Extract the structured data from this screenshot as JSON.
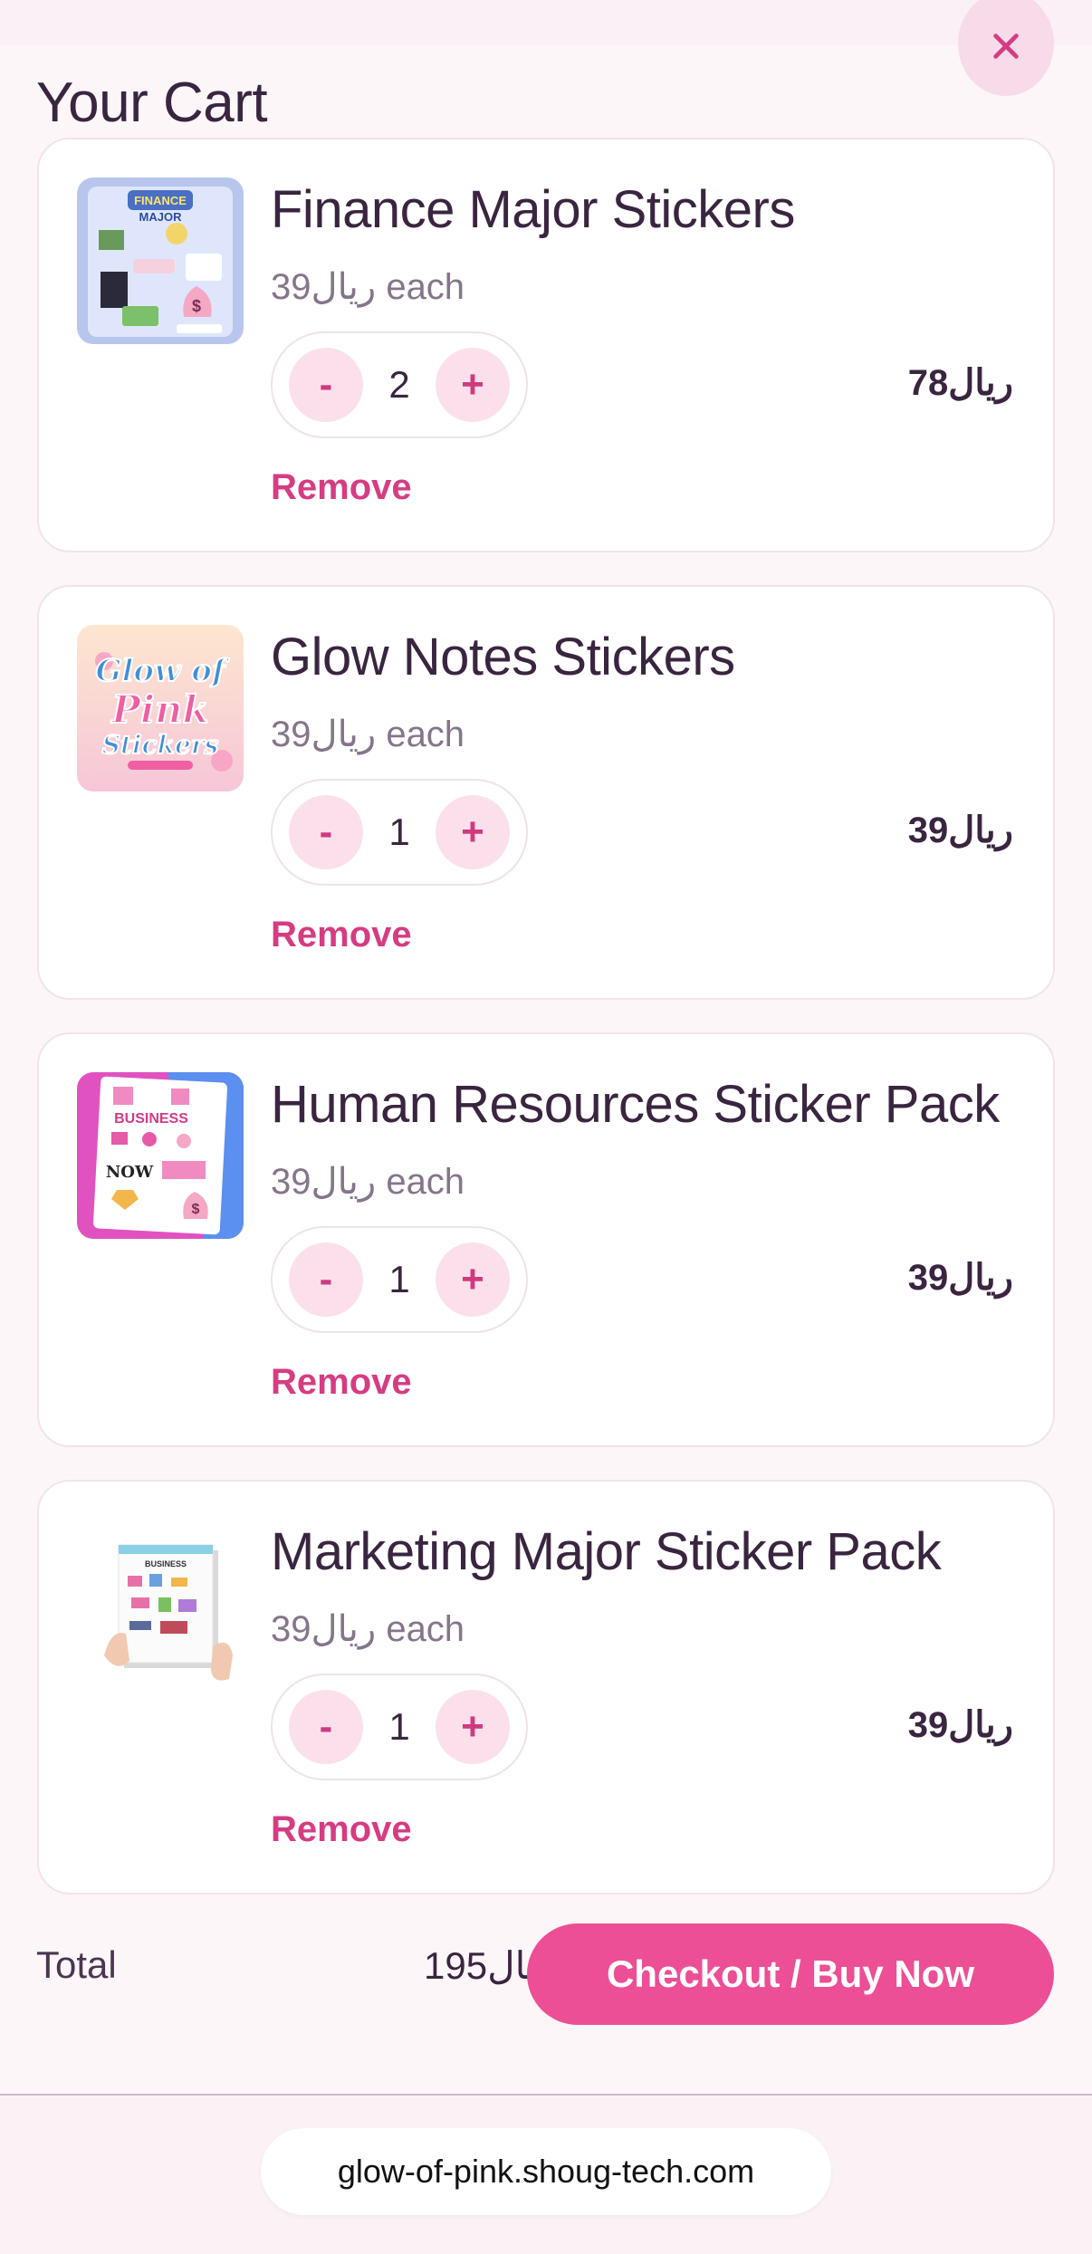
{
  "header": {
    "title": "Your Cart",
    "close_icon": "close-icon"
  },
  "items": [
    {
      "name": "Finance Major Stickers",
      "each": "39ريال each",
      "qty": "2",
      "minus": "-",
      "plus": "+",
      "total": "78ريال",
      "remove": "Remove",
      "thumb_text": [
        "FINANCE",
        "MAJOR"
      ]
    },
    {
      "name": "Glow Notes Stickers",
      "each": "39ريال each",
      "qty": "1",
      "minus": "-",
      "plus": "+",
      "total": "39ريال",
      "remove": "Remove",
      "thumb_text": [
        "Glow of",
        "Pink",
        "Stickers"
      ]
    },
    {
      "name": "Human Resources Sticker Pack",
      "each": "39ريال each",
      "qty": "1",
      "minus": "-",
      "plus": "+",
      "total": "39ريال",
      "remove": "Remove",
      "thumb_text": [
        "BUSINESS",
        "NOW"
      ]
    },
    {
      "name": "Marketing Major Sticker Pack",
      "each": "39ريال each",
      "qty": "1",
      "minus": "-",
      "plus": "+",
      "total": "39ريال",
      "remove": "Remove",
      "thumb_text": [
        "BUSINESS"
      ]
    }
  ],
  "summary": {
    "total_label": "Total",
    "total_value": "195ريال",
    "checkout_label": "Checkout / Buy Now"
  },
  "browser": {
    "url": "glow-of-pink.shoug-tech.com"
  },
  "colors": {
    "accent": "#ec4f95",
    "remove": "#d63c82",
    "background": "#fdf6f9"
  }
}
